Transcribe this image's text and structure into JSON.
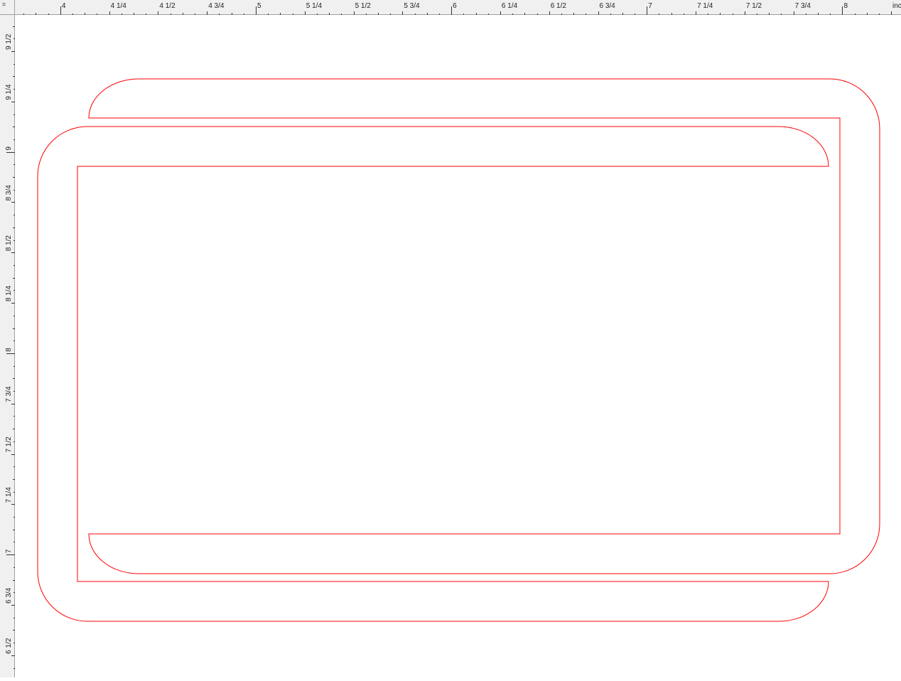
{
  "corner": {
    "icon": "origin-crosshair-icon",
    "glyph": "⌗"
  },
  "rulers": {
    "unit": "inches",
    "horizontal": {
      "start": 3.768,
      "end": 8.3,
      "labels": [
        {
          "value": 4,
          "text": "4"
        },
        {
          "value": 4.25,
          "text": "4  1/4"
        },
        {
          "value": 4.5,
          "text": "4  1/2"
        },
        {
          "value": 4.75,
          "text": "4  3/4"
        },
        {
          "value": 5,
          "text": "5"
        },
        {
          "value": 5.25,
          "text": "5  1/4"
        },
        {
          "value": 5.5,
          "text": "5  1/2"
        },
        {
          "value": 5.75,
          "text": "5  3/4"
        },
        {
          "value": 6,
          "text": "6"
        },
        {
          "value": 6.25,
          "text": "6  1/4"
        },
        {
          "value": 6.5,
          "text": "6  1/2"
        },
        {
          "value": 6.75,
          "text": "6  3/4"
        },
        {
          "value": 7,
          "text": "7"
        },
        {
          "value": 7.25,
          "text": "7  1/4"
        },
        {
          "value": 7.5,
          "text": "7  1/2"
        },
        {
          "value": 7.75,
          "text": "7  3/4"
        },
        {
          "value": 8,
          "text": "8"
        }
      ],
      "unit_label": "inc"
    },
    "vertical": {
      "top": 9.68,
      "bottom": 6.39,
      "labels": [
        {
          "value": 9.5,
          "text": "9  1/2"
        },
        {
          "value": 9.25,
          "text": "9  1/4"
        },
        {
          "value": 9,
          "text": "9"
        },
        {
          "value": 8.75,
          "text": "8  3/4"
        },
        {
          "value": 8.5,
          "text": "8  1/2"
        },
        {
          "value": 8.25,
          "text": "8  1/4"
        },
        {
          "value": 8,
          "text": "8"
        },
        {
          "value": 7.75,
          "text": "7  3/4"
        },
        {
          "value": 7.5,
          "text": "7  1/2"
        },
        {
          "value": 7.25,
          "text": "7  1/4"
        },
        {
          "value": 7,
          "text": "7"
        },
        {
          "value": 6.75,
          "text": "6  3/4"
        },
        {
          "value": 6.5,
          "text": "6  1/2"
        }
      ]
    }
  },
  "drawing": {
    "stroke_color": "#ff0000",
    "shapes": [
      {
        "name": "upper-u-shape",
        "description": "rounded U outline, open at left"
      },
      {
        "name": "lower-u-shape",
        "description": "rounded U outline, open at right"
      }
    ]
  }
}
